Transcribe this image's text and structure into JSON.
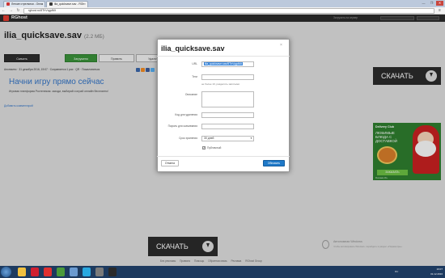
{
  "browser": {
    "tabs": [
      {
        "label": "Легкие стрелялки - Онла"
      },
      {
        "label": "ilia_quicksave.sav - RGh"
      }
    ],
    "url": "rghost.ru/8ThVqgdMt",
    "window_buttons": [
      "—",
      "❐",
      "✕"
    ]
  },
  "site": {
    "name": "RGhost",
    "links": "Загрузить на сервер"
  },
  "file": {
    "title": "ilia_quicksave.sav",
    "size": "(2.2 МБ)"
  },
  "actions": {
    "download": "Скачать",
    "added": "Загружено",
    "edit": "Править",
    "delete": "Удалить"
  },
  "meta": "Анонимно  ·  31 декабря 2016, 19:07  ·  Сохраняется 1 раз  ·  QR  ·  Пожаловаться",
  "ad_banner": {
    "title": "Начни игру прямо сейчас",
    "text": "Игровая платформа Ростелеком: заходи, выбирай и играй онлайн бесплатно!"
  },
  "add_comment": "Добавить комментарий",
  "big_download": "СКАЧАТЬ",
  "side_ad": {
    "brand": "Delivery Club",
    "headline": "ЛЮБИМЫЕ БЛЮДА С ДОСТАВКОЙ",
    "order": "ЗАКАЗАТЬ",
    "fine": "Реклама 18+"
  },
  "footer": {
    "brand": "Автономная Windows",
    "note": "Чтобы активировать Windows, перейдите в раздел «Параметры».",
    "links": [
      "Без рекламы",
      "Правила",
      "Помощь",
      "Обратная связь",
      "Реклама",
      "RGhost Group"
    ]
  },
  "dialog": {
    "title": "ilia_quicksave.sav",
    "close": "×",
    "url_label": "URL",
    "url_value": "ilia_quicksave.sav/8ThVqgdMt",
    "tags_label": "Теги",
    "tags_hint": "не более 10, разделять запятыми",
    "description_label": "Описание",
    "delete_code_label": "Код для удаления",
    "view_password_label": "Пароль для скачивания",
    "lifetime_label": "Срок хранения",
    "lifetime_value": "30 дней",
    "public_label": "Публичный",
    "public_checked": true,
    "cancel": "Отмена",
    "save": "Обновить"
  },
  "taskbar": {
    "icons": [
      {
        "name": "explorer-icon",
        "color": "#f0c040"
      },
      {
        "name": "opera-icon",
        "color": "#d02030"
      },
      {
        "name": "yandex-icon",
        "color": "#e03030"
      },
      {
        "name": "chrome-icon",
        "color": "#4a9a3a"
      },
      {
        "name": "paint-icon",
        "color": "#6a9ad0"
      },
      {
        "name": "skype-icon",
        "color": "#29a8e0"
      },
      {
        "name": "game-icon",
        "color": "#7a7a7a"
      },
      {
        "name": "app-icon",
        "color": "#2a2a2a"
      }
    ],
    "tray": "RU",
    "time": "19:07",
    "date": "31.12.2016"
  }
}
